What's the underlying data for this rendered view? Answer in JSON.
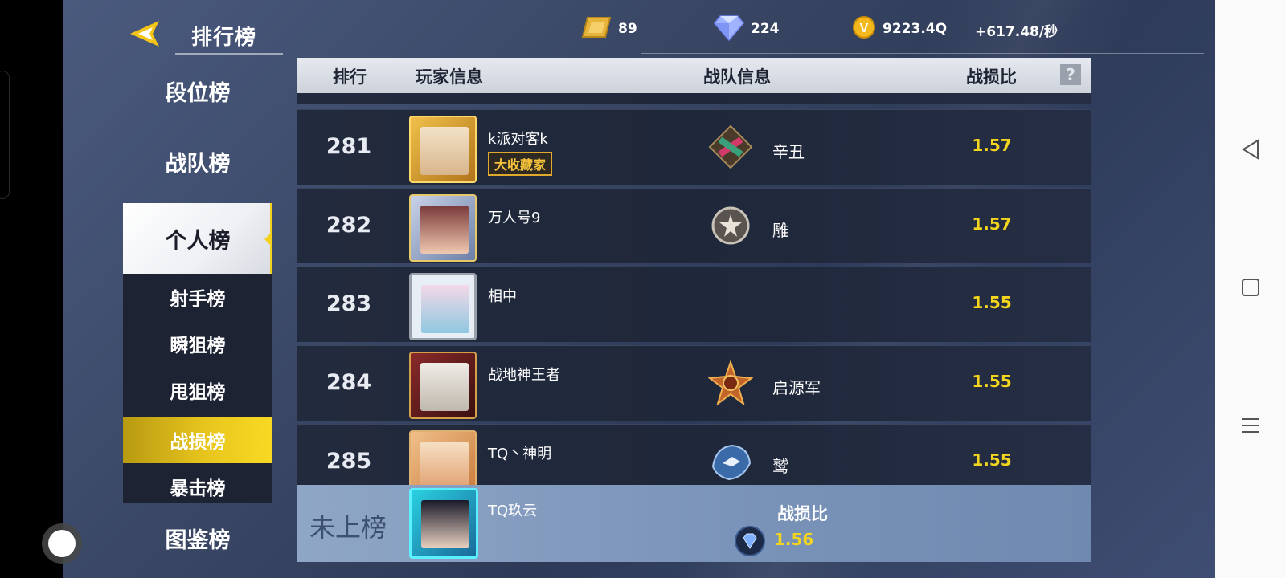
{
  "header": {
    "title": "排行榜",
    "currencies": [
      {
        "icon": "gold-ticket-icon",
        "value": "89"
      },
      {
        "icon": "diamond-icon",
        "value": "224"
      },
      {
        "icon": "coin-icon",
        "value": "9223.4Q"
      }
    ],
    "income_rate": "+617.48/秒"
  },
  "sidebar": {
    "main_items": [
      "段位榜",
      "战队榜",
      "个人榜",
      "图鉴榜"
    ],
    "sub_items": [
      "射手榜",
      "瞬狙榜",
      "甩狙榜",
      "战损榜",
      "暴击榜"
    ],
    "selected_main": "个人榜",
    "selected_sub": "战损榜"
  },
  "table": {
    "columns": [
      "排行",
      "玩家信息",
      "战队信息",
      "战损比"
    ],
    "help": "?",
    "rows": [
      {
        "rank": "281",
        "player": "k派对客k",
        "badge": "大收藏家",
        "team": "辛丑",
        "kd": "1.57"
      },
      {
        "rank": "282",
        "player": "万人号9",
        "badge": "",
        "team": "雕",
        "kd": "1.57"
      },
      {
        "rank": "283",
        "player": "相中",
        "badge": "",
        "team": "",
        "kd": "1.55"
      },
      {
        "rank": "284",
        "player": "战地神王者",
        "badge": "",
        "team": "启源军",
        "kd": "1.55"
      },
      {
        "rank": "285",
        "player": "TQ丶神明",
        "badge": "",
        "team": "鹫",
        "kd": "1.55"
      }
    ]
  },
  "my_entry": {
    "rank_label": "未上榜",
    "player": "TQ玖云",
    "kd_label": "战损比",
    "kd": "1.56"
  },
  "colors": {
    "accent_yellow": "#f3d51e",
    "badge_gold": "#e1a92c",
    "row_bg": "#222a3d",
    "my_row_bg": "#7a93b8"
  }
}
